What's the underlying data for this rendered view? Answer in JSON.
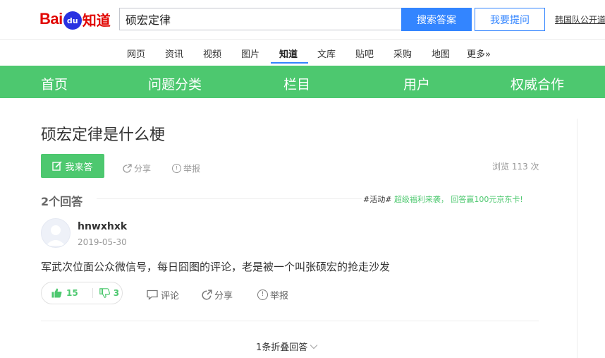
{
  "logo": {
    "bai": "Bai",
    "du": "du",
    "zhidao": "知道"
  },
  "search": {
    "value": "硕宏定律",
    "button": "搜索答案",
    "ask_button": "我要提问"
  },
  "top_link": "韩国队公开道",
  "channels": [
    "网页",
    "资讯",
    "视频",
    "图片",
    "知道",
    "文库",
    "贴吧",
    "采购",
    "地图",
    "更多»"
  ],
  "nav": [
    "首页",
    "问题分类",
    "栏目",
    "用户",
    "权威合作"
  ],
  "question": {
    "title": "硕宏定律是什么梗",
    "answer_button": "我来答",
    "share": "分享",
    "report": "举报",
    "views": "浏览 113 次"
  },
  "answers": {
    "count": "2个回答",
    "promo_tag": "#活动#",
    "promo_text": "超级福利来袭，  回答赢100元京东卡!"
  },
  "answer": {
    "username": "hnwxhxk",
    "date": "2019-05-30",
    "text": "军武次位面公众微信号，每日囧图的评论，老是被一个叫张硕宏的抢走沙发",
    "likes": "15",
    "dislikes": "3",
    "comment": "评论",
    "share": "分享",
    "report": "举报"
  },
  "folded": "1条折叠回答",
  "colors": {
    "green": "#4dc86f",
    "blue": "#3385ff",
    "red": "#e10601"
  }
}
